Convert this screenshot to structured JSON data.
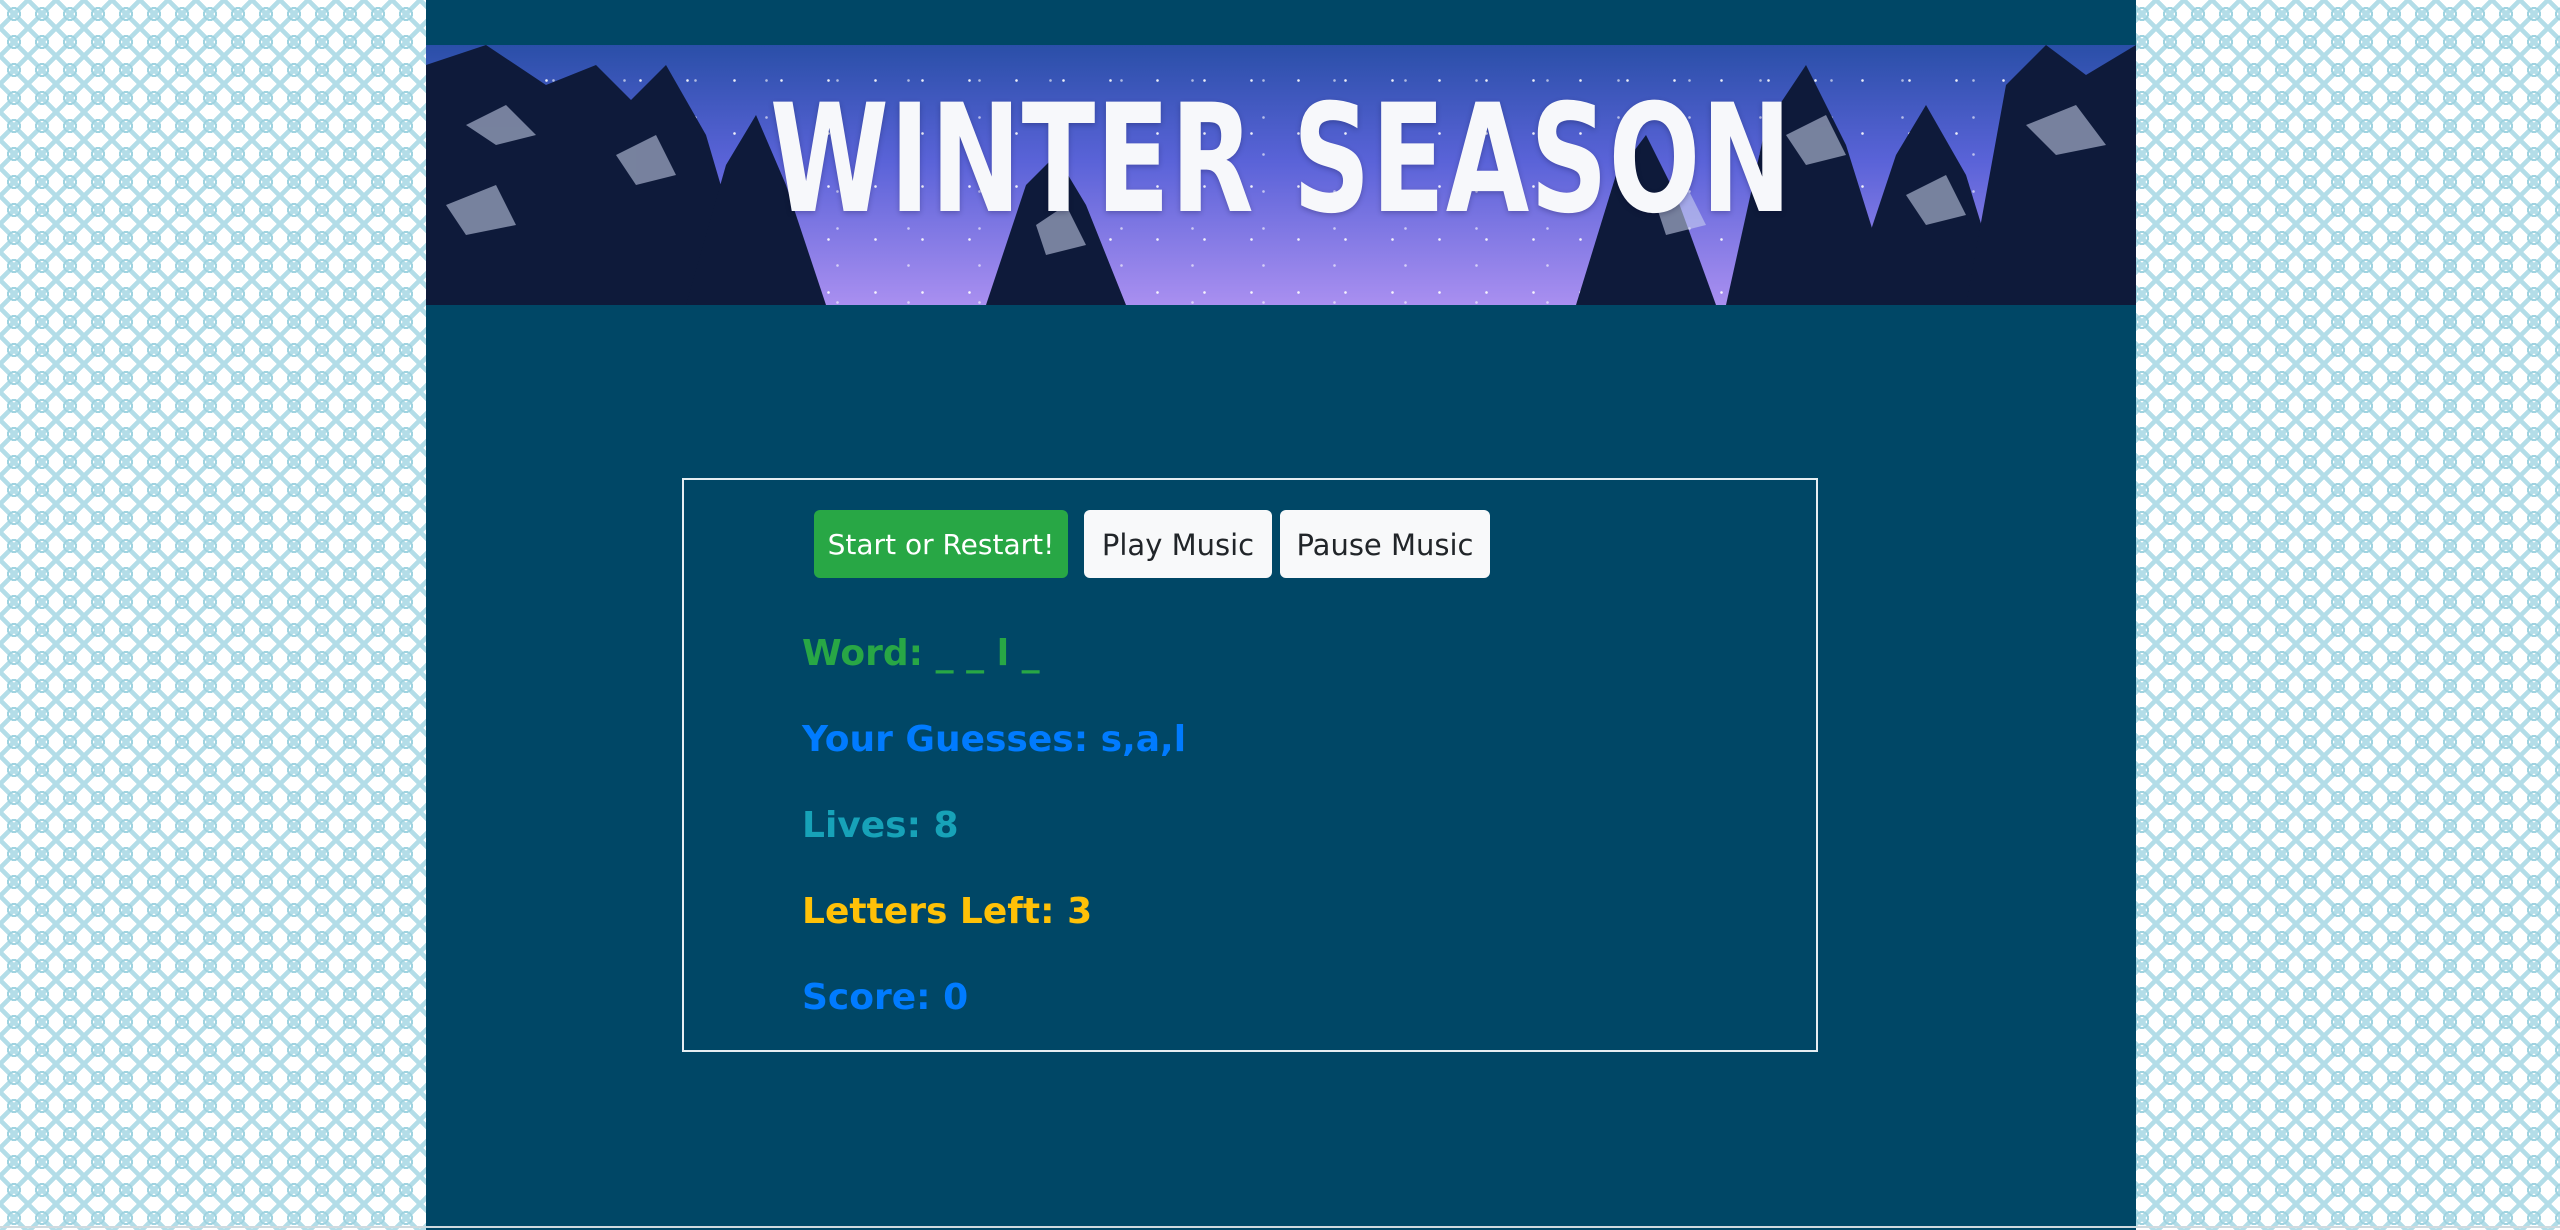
{
  "banner": {
    "title": "WINTER SEASON"
  },
  "controls": {
    "start_label": "Start or Restart!",
    "play_music_label": "Play Music",
    "pause_music_label": "Pause Music"
  },
  "stats": {
    "word_label": "Word:",
    "word_value": "_ _ l _",
    "guesses_label": "Your Guesses:",
    "guesses_value": "s,a,l",
    "lives_label": "Lives:",
    "lives_value": "8",
    "letters_left_label": "Letters Left:",
    "letters_left_value": "3",
    "score_label": "Score:",
    "score_value": "0"
  },
  "colors": {
    "page_background": "#004766",
    "word": "#28a745",
    "guesses": "#007bff",
    "lives": "#17a2b8",
    "letters_left": "#ffc107",
    "score": "#007bff",
    "start_button": "#28a745"
  }
}
